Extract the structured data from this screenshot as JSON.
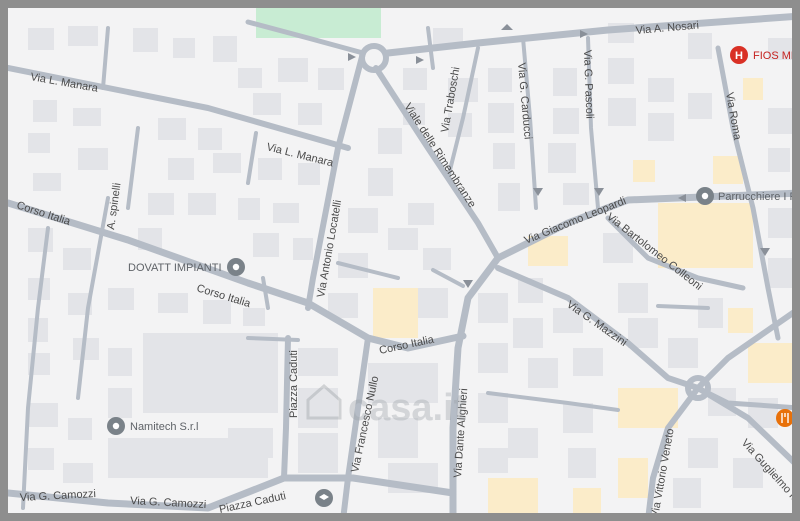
{
  "map": {
    "colors": {
      "background": "#f3f3f4",
      "road": "#b5bcc6",
      "building": "#e3e4e8",
      "park": "#c8ecd3",
      "highlight": "#fbecc9",
      "poi_grey": "#7a8289",
      "poi_red": "#d93025",
      "poi_orange": "#e8710a"
    },
    "streets": {
      "via_a_nosari": "Via A. Nosari",
      "via_l_manara_1": "Via L. Manara",
      "via_l_manara_2": "Via L. Manara",
      "via_traboschi": "Via Traboschi",
      "via_g_carducci": "Via G. Carducci",
      "via_g_pascoli": "Via G. Pascoli",
      "via_roma": "Via Roma",
      "viale_delle_rimembranze": "Viale delle Rimembranze",
      "via_giacomo_leopardi": "Via Giacomo Leopardi",
      "via_bartolomeo_colleoni": "Via Bartolomeo Colleoni",
      "corso_italia_1": "Corso Italia",
      "corso_italia_2": "Corso Italia",
      "corso_italia_3": "Corso Italia",
      "via_antonio_locatelli": "Via Antonio Locatelli",
      "a_spinelli": "A. spinelli",
      "via_g_mazzini": "Via G. Mazzini",
      "piazza_caduti_1": "Piazza Caduti",
      "piazza_caduti_2": "Piazza Caduti",
      "via_francesco_nullo": "Via Francesco Nullo",
      "via_dante_alighieri": "Via Dante Alighieri",
      "via_vittorio_veneto": "Via Vittorio Veneto",
      "via_guglielmo_marconi": "Via Guglielmo Marc",
      "via_g_camozzi_1": "Via G. Camozzi",
      "via_g_camozzi_2": "Via G. Camozzi"
    },
    "pois": {
      "dovatt": {
        "label": "DOVATT IMPIANTI",
        "icon": "location-pin-icon"
      },
      "namitech": {
        "label": "Namitech S.r.l",
        "icon": "location-pin-icon"
      },
      "parrucchiere": {
        "label": "Parrucchiere I F",
        "icon": "location-pin-icon"
      },
      "fios": {
        "label": "FIOS MED",
        "icon": "hospital-icon"
      },
      "restaurant": {
        "icon": "restaurant-icon"
      },
      "school": {
        "icon": "school-icon"
      }
    },
    "watermark": "casa.it"
  }
}
